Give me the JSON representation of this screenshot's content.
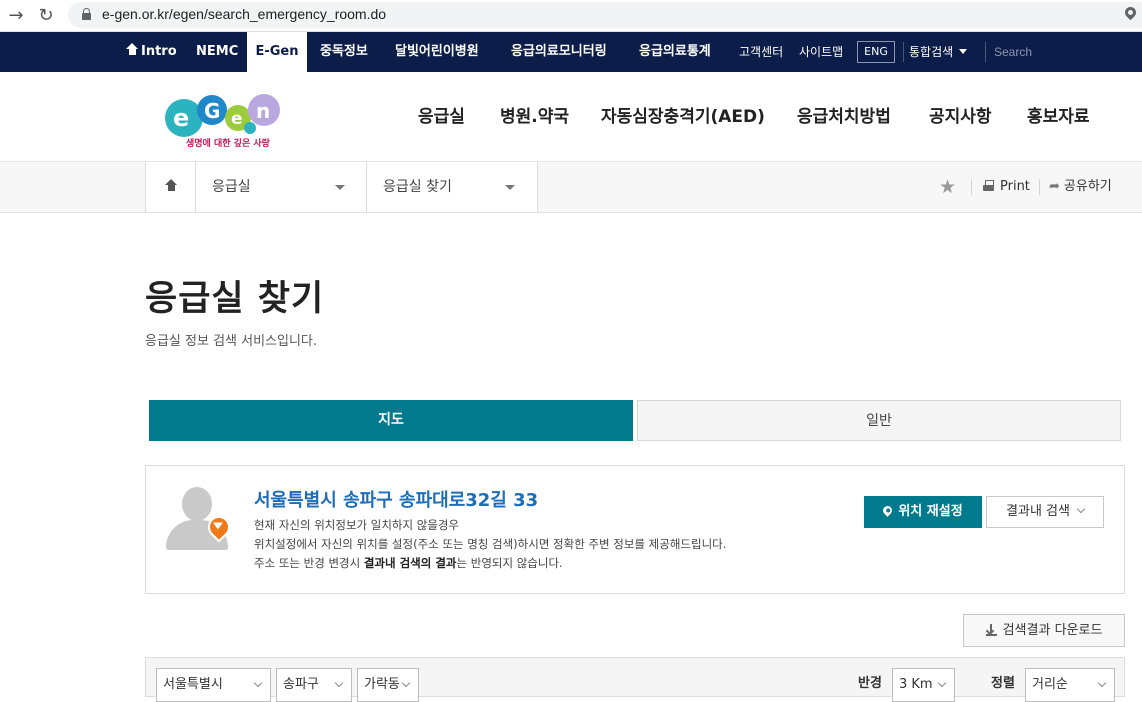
{
  "browser": {
    "url": "e-gen.or.kr/egen/search_emergency_room.do"
  },
  "gnb": {
    "items": [
      "Intro",
      "NEMC",
      "E-Gen",
      "중독정보",
      "달빛어린이병원",
      "응급의료모니터링",
      "응급의료통계"
    ],
    "small": [
      "고객센터",
      "사이트맵"
    ],
    "eng": "ENG",
    "unified_search": "통합검색",
    "search_placeholder": "Search"
  },
  "header": {
    "logo_text": "생명에 대한 깊은 사랑",
    "nav": [
      "응급실",
      "병원.약국",
      "자동심장충격기(AED)",
      "응급처치방법",
      "공지사항",
      "홍보자료"
    ]
  },
  "location": {
    "depth1": "응급실",
    "depth2": "응급실 찾기",
    "print": "Print",
    "share": "공유하기"
  },
  "page": {
    "title": "응급실 찾기",
    "desc": "응급실 정보 검색 서비스입니다."
  },
  "tabs": [
    "지도",
    "일반"
  ],
  "info": {
    "address": "서울특별시 송파구 송파대로32길 33",
    "line1": "현재 자신의 위치정보가 일치하지 않을경우",
    "line2": "위치설정에서 자신의 위치를 설정(주소 또는 명칭 검색)하시면 정확한 주변 정보를 제공해드립니다.",
    "line3_pre": "주소 또는 반경 변경시 ",
    "line3_bold": "결과내 검색의 결과",
    "line3_post": "는 반영되지 않습니다.",
    "reset_btn": "위치 재설정",
    "filter_btn": "결과내 검색"
  },
  "download_btn": "검색결과 다운로드",
  "filters": {
    "sido": "서울특별시",
    "gugun": "송파구",
    "dong": "가락동",
    "radius_label": "반경",
    "radius": "3 Km",
    "sort_label": "정렬",
    "sort": "거리순"
  },
  "colors": {
    "navy": "#0b1d48",
    "teal": "#007a8c",
    "link_blue": "#1e6db8",
    "pin_orange": "#f07a1a"
  }
}
